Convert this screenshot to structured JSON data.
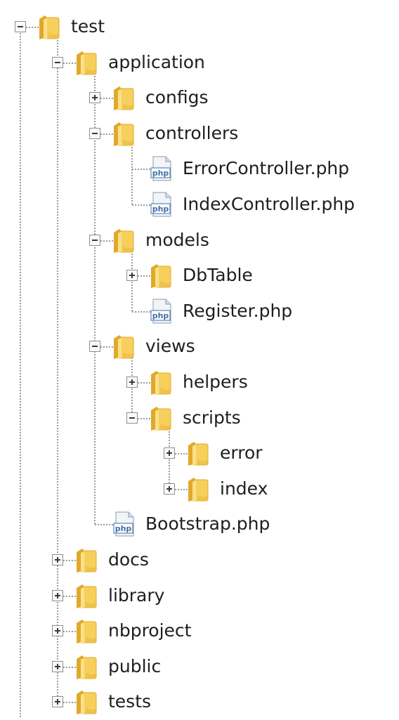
{
  "tree": {
    "nodes": [
      {
        "id": "test",
        "label": "test",
        "kind": "folder",
        "depth": 0,
        "expanded": true,
        "icon": "folder-icon"
      },
      {
        "id": "application",
        "label": "application",
        "kind": "folder",
        "depth": 1,
        "expanded": true,
        "icon": "folder-icon"
      },
      {
        "id": "configs",
        "label": "configs",
        "kind": "folder",
        "depth": 2,
        "expanded": false,
        "icon": "folder-icon"
      },
      {
        "id": "controllers",
        "label": "controllers",
        "kind": "folder",
        "depth": 2,
        "expanded": true,
        "icon": "folder-icon"
      },
      {
        "id": "error-controller",
        "label": "ErrorController.php",
        "kind": "php",
        "depth": 3,
        "icon": "php-file-icon"
      },
      {
        "id": "index-controller",
        "label": "IndexController.php",
        "kind": "php",
        "depth": 3,
        "icon": "php-file-icon"
      },
      {
        "id": "models",
        "label": "models",
        "kind": "folder",
        "depth": 2,
        "expanded": true,
        "icon": "folder-icon"
      },
      {
        "id": "dbtable",
        "label": "DbTable",
        "kind": "folder",
        "depth": 3,
        "expanded": false,
        "icon": "folder-icon"
      },
      {
        "id": "register",
        "label": "Register.php",
        "kind": "php",
        "depth": 3,
        "icon": "php-file-icon"
      },
      {
        "id": "views",
        "label": "views",
        "kind": "folder",
        "depth": 2,
        "expanded": true,
        "icon": "folder-icon"
      },
      {
        "id": "helpers",
        "label": "helpers",
        "kind": "folder",
        "depth": 3,
        "expanded": false,
        "icon": "folder-icon"
      },
      {
        "id": "scripts",
        "label": "scripts",
        "kind": "folder",
        "depth": 3,
        "expanded": true,
        "icon": "folder-icon"
      },
      {
        "id": "error",
        "label": "error",
        "kind": "folder",
        "depth": 4,
        "expanded": false,
        "icon": "folder-icon"
      },
      {
        "id": "index",
        "label": "index",
        "kind": "folder",
        "depth": 4,
        "expanded": false,
        "icon": "folder-icon"
      },
      {
        "id": "bootstrap",
        "label": "Bootstrap.php",
        "kind": "php",
        "depth": 2,
        "icon": "php-file-icon"
      },
      {
        "id": "docs",
        "label": "docs",
        "kind": "folder",
        "depth": 1,
        "expanded": false,
        "icon": "folder-icon"
      },
      {
        "id": "library",
        "label": "library",
        "kind": "folder",
        "depth": 1,
        "expanded": false,
        "icon": "folder-icon"
      },
      {
        "id": "nbproject",
        "label": "nbproject",
        "kind": "folder",
        "depth": 1,
        "expanded": false,
        "icon": "folder-icon"
      },
      {
        "id": "public",
        "label": "public",
        "kind": "folder",
        "depth": 1,
        "expanded": false,
        "icon": "folder-icon"
      },
      {
        "id": "tests",
        "label": "tests",
        "kind": "folder",
        "depth": 1,
        "expanded": false,
        "icon": "folder-icon"
      }
    ]
  },
  "colors": {
    "folder_fill": "#f7cf5c",
    "folder_shade": "#e0a92b",
    "php_icon": "#3f6fa6",
    "connector": "#9a9a9a"
  },
  "icon_text": {
    "php": "php"
  }
}
